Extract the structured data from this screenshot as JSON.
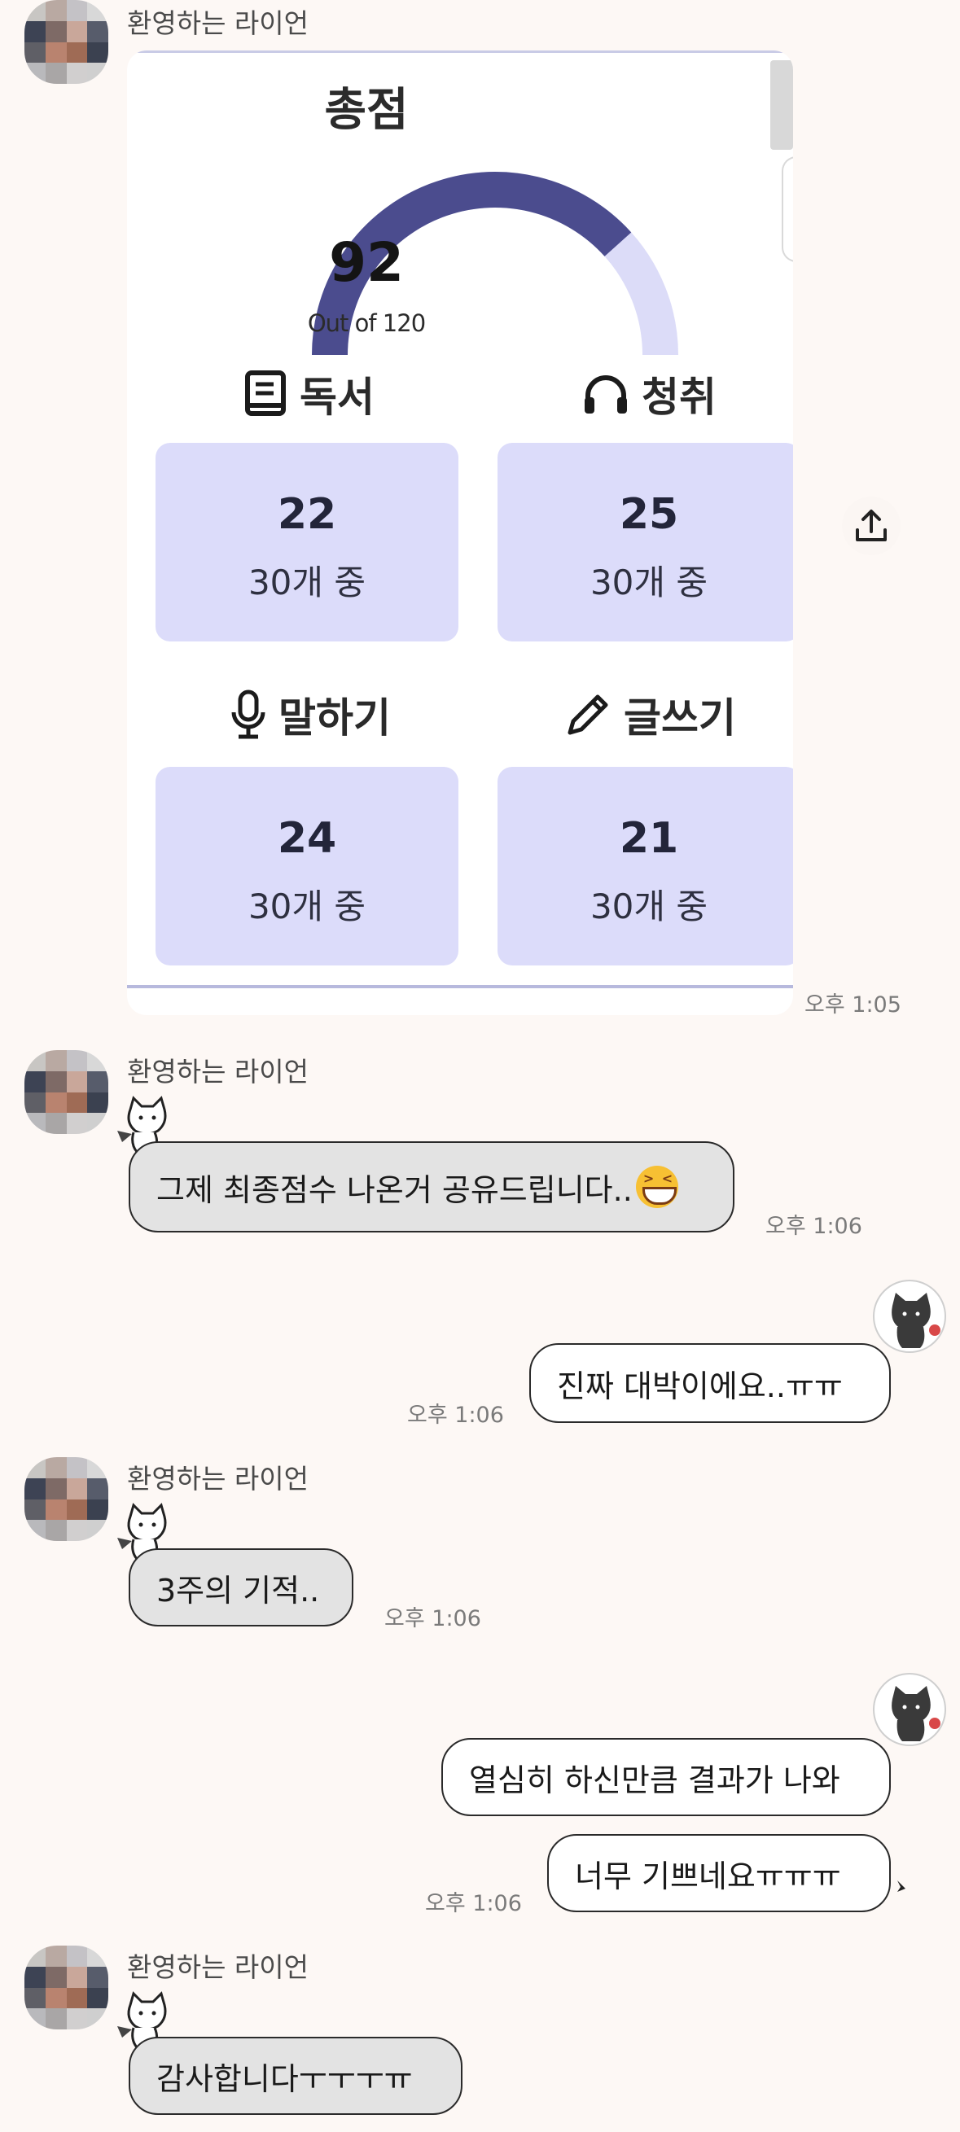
{
  "chat": {
    "sender_name": "환영하는 라이언",
    "times": {
      "t1": "오후 1:05",
      "t2": "오후 1:06",
      "t3": "오후 1:06",
      "t4": "오후 1:06",
      "t5": "오후 1:06"
    },
    "messages": {
      "m1": "그제 최종점수 나온거 공유드립니다..",
      "m2": "진짜 대박이에요..ㅠㅠ",
      "m3": "3주의 기적..",
      "m4": "열심히 하신만큼 결과가 나와",
      "m5": "너무 기쁘네요ㅠㅠㅠ",
      "m6": "감사합니다ㅜㅜㅜㅠ"
    }
  },
  "score_card": {
    "title": "총점",
    "score": "92",
    "out_of": "Out of 120",
    "gauge_fraction": 0.7667,
    "colors": {
      "gauge_fill": "#4b4c8e",
      "gauge_track": "#dcdcf8",
      "tile_bg": "#dcdcfa"
    },
    "skills": {
      "reading": {
        "label": "독서",
        "icon": "book-icon",
        "value": "22",
        "sub": "30개 중"
      },
      "listening": {
        "label": "청취",
        "icon": "headphones-icon",
        "value": "25",
        "sub": "30개 중"
      },
      "speaking": {
        "label": "말하기",
        "icon": "microphone-icon",
        "value": "24",
        "sub": "30개 중"
      },
      "writing": {
        "label": "글쓰기",
        "icon": "pencil-icon",
        "value": "21",
        "sub": "30개 중"
      }
    }
  }
}
